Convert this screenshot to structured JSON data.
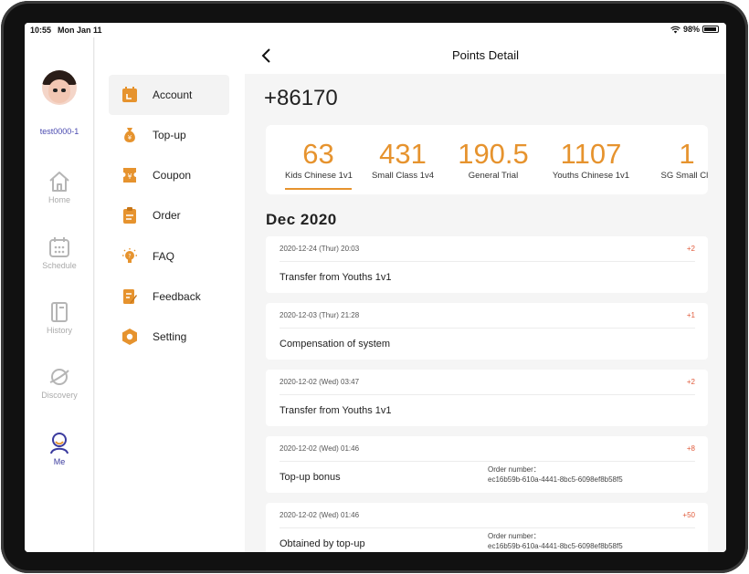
{
  "status_bar": {
    "time": "10:55",
    "date": "Mon Jan 11",
    "battery": "98%"
  },
  "user": {
    "name": "test0000-1"
  },
  "rail": [
    {
      "label": "Home",
      "icon": "home-icon"
    },
    {
      "label": "Schedule",
      "icon": "calendar-icon"
    },
    {
      "label": "History",
      "icon": "book-icon"
    },
    {
      "label": "Discovery",
      "icon": "planet-icon"
    },
    {
      "label": "Me",
      "icon": "person-icon",
      "active": true
    }
  ],
  "menu": [
    {
      "label": "Account",
      "icon": "calendar-icon",
      "active": true
    },
    {
      "label": "Top-up",
      "icon": "money-bag-icon"
    },
    {
      "label": "Coupon",
      "icon": "coupon-icon"
    },
    {
      "label": "Order",
      "icon": "clipboard-icon"
    },
    {
      "label": "FAQ",
      "icon": "lightbulb-icon"
    },
    {
      "label": "Feedback",
      "icon": "edit-icon"
    },
    {
      "label": "Setting",
      "icon": "hexagon-gear-icon"
    }
  ],
  "header": {
    "title": "Points Detail"
  },
  "total_points": "+86170",
  "categories": [
    {
      "value": "63",
      "name": "Kids Chinese 1v1",
      "active": true
    },
    {
      "value": "431",
      "name": "Small Class 1v4"
    },
    {
      "value": "190.5",
      "name": "General Trial"
    },
    {
      "value": "1107",
      "name": "Youths Chinese 1v1"
    },
    {
      "value": "1",
      "name": "SG Small Cla"
    }
  ],
  "month": "Dec 2020",
  "records": [
    {
      "date": "2020-12-24 (Thur) 20:03",
      "delta": "+2",
      "desc": "Transfer from Youths 1v1"
    },
    {
      "date": "2020-12-03 (Thur) 21:28",
      "delta": "+1",
      "desc": "Compensation of system"
    },
    {
      "date": "2020-12-02 (Wed) 03:47",
      "delta": "+2",
      "desc": "Transfer from Youths 1v1"
    },
    {
      "date": "2020-12-02 (Wed) 01:46",
      "delta": "+8",
      "desc": "Top-up bonus",
      "order_label": "Order number：",
      "order_number": "ec16b59b-610a-4441-8bc5-6098ef8b58f5"
    },
    {
      "date": "2020-12-02 (Wed) 01:46",
      "delta": "+50",
      "desc": "Obtained by top-up",
      "order_label": "Order number：",
      "order_number": "ec16b59b-610a-4441-8bc5-6098ef8b58f5"
    }
  ],
  "colors": {
    "accent": "#e6932e",
    "delta": "#e05a3a",
    "active_nav": "#3b3b9e"
  }
}
